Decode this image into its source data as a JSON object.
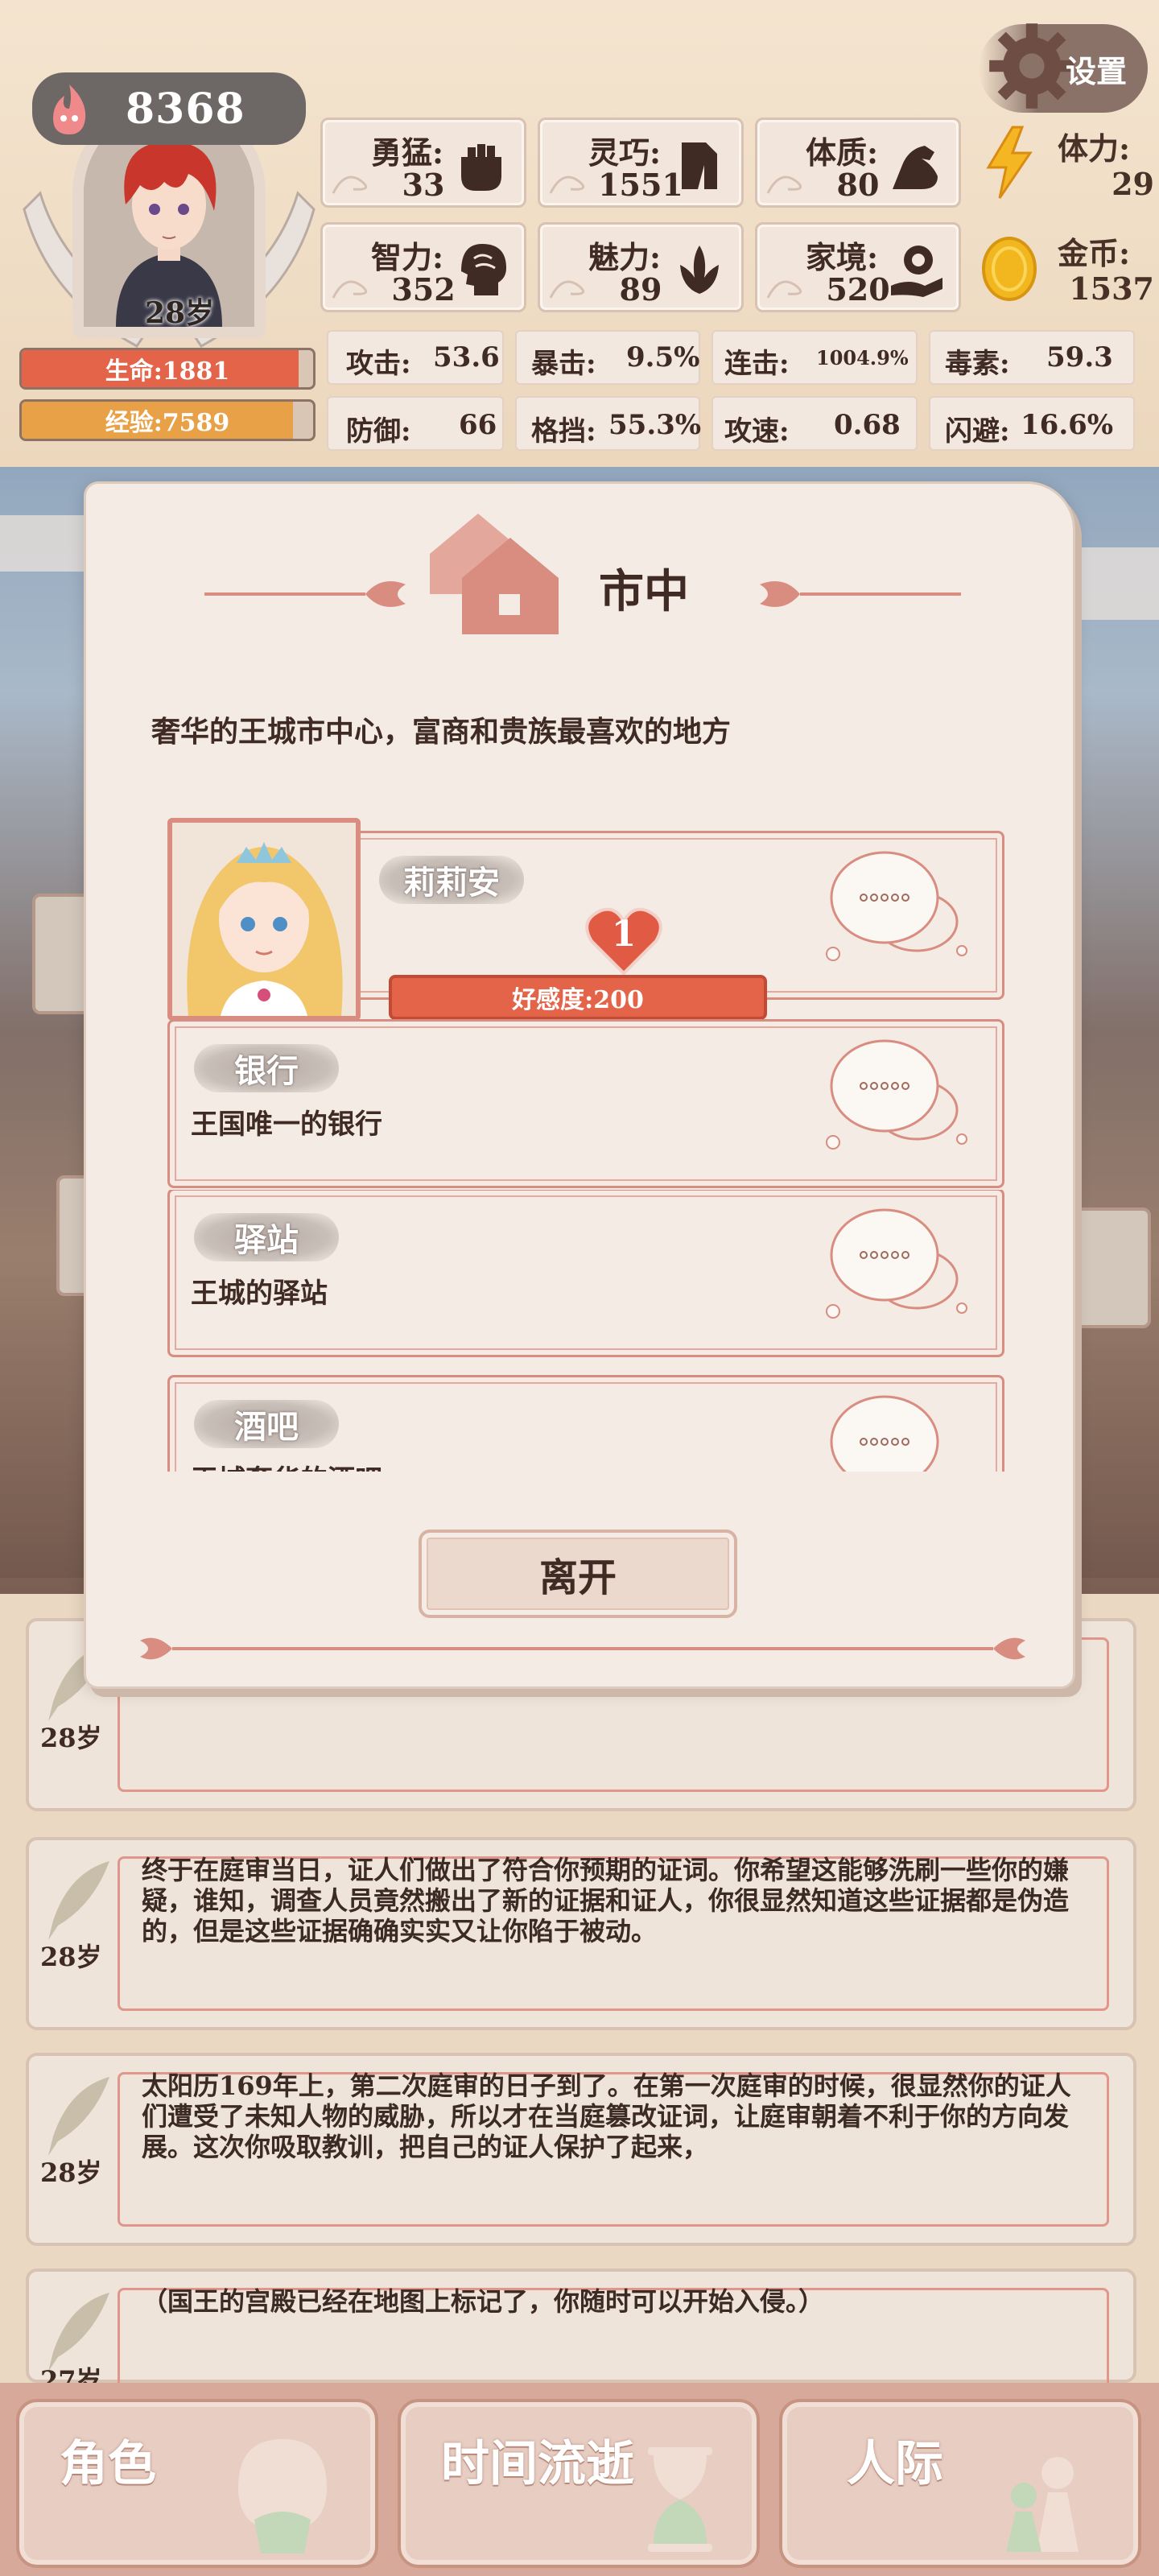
{
  "settings": {
    "label": "设置"
  },
  "player": {
    "soul_points": "8368",
    "age": "28岁",
    "hp_label": "生命:1881",
    "hp_fraction": 0.95,
    "xp_label": "经验:7589",
    "xp_fraction": 0.93
  },
  "attributes": [
    {
      "label": "勇猛:",
      "value": "33",
      "icon": "fist-icon"
    },
    {
      "label": "灵巧:",
      "value": "1551",
      "icon": "glove-icon"
    },
    {
      "label": "体质:",
      "value": "80",
      "icon": "muscle-arm-icon"
    },
    {
      "label": "智力:",
      "value": "352",
      "icon": "brain-head-icon"
    },
    {
      "label": "魅力:",
      "value": "89",
      "icon": "tulip-icon"
    },
    {
      "label": "家境:",
      "value": "520",
      "icon": "coin-hand-icon"
    }
  ],
  "resources": [
    {
      "label": "体力:",
      "value": "29",
      "icon": "lightning-icon"
    },
    {
      "label": "金币:",
      "value": "1537",
      "icon": "gold-coin-icon"
    }
  ],
  "combat_stats": [
    {
      "label": "攻击:",
      "value": "53.6"
    },
    {
      "label": "暴击:",
      "value": "9.5%"
    },
    {
      "label": "连击:",
      "value": "1004.9%"
    },
    {
      "label": "毒素:",
      "value": "59.3"
    },
    {
      "label": "防御:",
      "value": "66"
    },
    {
      "label": "格挡:",
      "value": "55.3%"
    },
    {
      "label": "攻速:",
      "value": "0.68"
    },
    {
      "label": "闪避:",
      "value": "16.6%"
    }
  ],
  "modal": {
    "title": "市中",
    "description": "奢华的王城市中心，富商和贵族最喜欢的地方",
    "npc": {
      "name": "莉莉安",
      "badge": "1",
      "affinity": "好感度:200",
      "affinity_fraction": 1.0
    },
    "places": [
      {
        "name": "银行",
        "desc": "王国唯一的银行"
      },
      {
        "name": "驿站",
        "desc": "王城的驿站"
      },
      {
        "name": "酒吧",
        "desc": "王城奢华的酒吧"
      }
    ],
    "leave_label": "离开"
  },
  "log": [
    {
      "age": "28岁",
      "text": ""
    },
    {
      "age": "28岁",
      "text": "终于在庭审当日，证人们做出了符合你预期的证词。你希望这能够洗刷一些你的嫌疑，谁知，调查人员竟然搬出了新的证据和证人，你很显然知道这些证据都是伪造的，但是这些证据确确实实又让你陷于被动。"
    },
    {
      "age": "28岁",
      "text": "太阳历169年上，第二次庭审的日子到了。在第一次庭审的时候，很显然你的证人们遭受了未知人物的威胁，所以才在当庭篡改证词，让庭审朝着不利于你的方向发展。这次你吸取教训，把自己的证人保护了起来，"
    },
    {
      "age": "27岁",
      "text": "（国王的宫殿已经在地图上标记了，你随时可以开始入侵。）"
    }
  ],
  "nav": [
    {
      "label": "角色",
      "icon": "character-bust-icon"
    },
    {
      "label": "时间流逝",
      "icon": "hourglass-icon"
    },
    {
      "label": "人际",
      "icon": "people-pawns-icon"
    }
  ]
}
